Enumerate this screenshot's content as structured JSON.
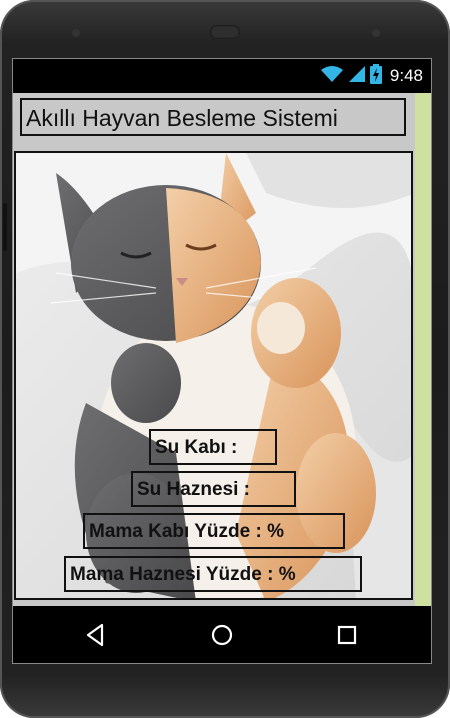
{
  "status_bar": {
    "time": "9:48",
    "icons": [
      "wifi-icon",
      "signal-icon",
      "battery-icon"
    ]
  },
  "app": {
    "title": "Akıllı Hayvan Besleme Sistemi",
    "labels": {
      "su_kabi": "Su Kabı :",
      "su_haznesi": "Su Haznesi :",
      "mama_kabi": "Mama Kabı Yüzde : %",
      "mama_haznesi": "Mama Haznesi Yüzde : %"
    }
  },
  "nav_bar": {
    "icons": [
      "back-icon",
      "home-icon",
      "recents-icon"
    ]
  },
  "colors": {
    "app_background": "#c8c8c8",
    "right_strip": "#cfe1a0",
    "status_icons": "#33b5e5"
  }
}
